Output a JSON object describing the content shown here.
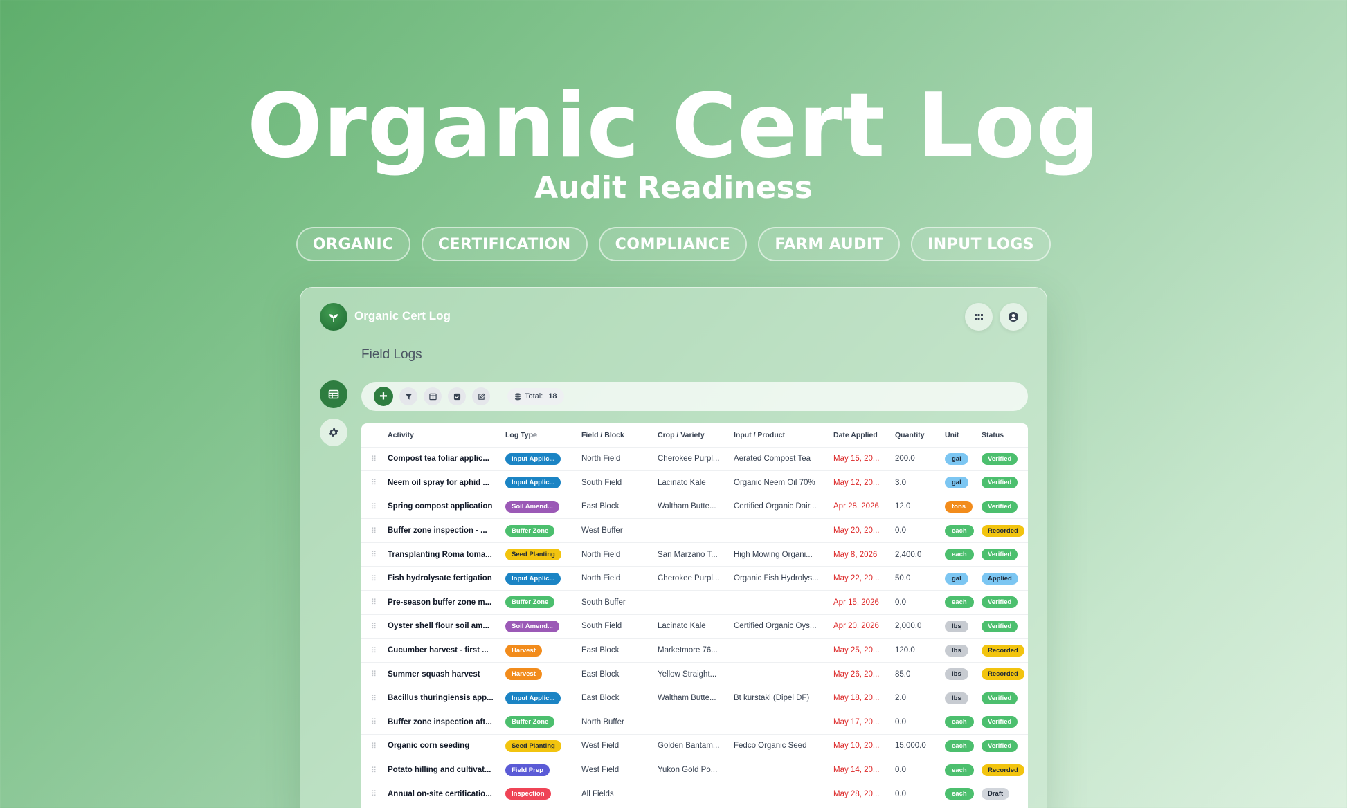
{
  "hero": {
    "title": "Organic Cert Log",
    "subtitle": "Audit Readiness",
    "tags": [
      "ORGANIC",
      "CERTIFICATION",
      "COMPLIANCE",
      "FARM AUDIT",
      "INPUT LOGS"
    ]
  },
  "app": {
    "title": "Organic Cert Log",
    "page_heading": "Field Logs",
    "toolbar": {
      "total_label": "Total:",
      "total_value": "18"
    },
    "columns": [
      "",
      "Activity",
      "Log Type",
      "Field / Block",
      "Crop / Variety",
      "Input / Product",
      "Date Applied",
      "Quantity",
      "Unit",
      "Status"
    ],
    "colors": {
      "brand": "#2e7d40",
      "input": "#1b84c4",
      "soil": "#9b59b6",
      "buffer": "#4cbf6e",
      "seed": "#f2c40f",
      "harvest": "#f28c1c",
      "fieldprep": "#5b5bd6",
      "inspection": "#ef4456",
      "gal": "#7cc6f2",
      "tons": "#f28c1c",
      "each": "#4cbf6e",
      "lbs": "#c7cbd1",
      "verified": "#4cbf6e",
      "recorded": "#f2c40f",
      "applied": "#7cc6f2",
      "draft": "#d1d5db"
    },
    "rows": [
      {
        "activity": "Compost tea foliar applic...",
        "type": "Input Applic...",
        "type_color": "input",
        "field": "North Field",
        "crop": "Cherokee Purpl...",
        "product": "Aerated Compost Tea",
        "date": "May 15, 20...",
        "qty": "200.0",
        "unit": "gal",
        "status": "Verified"
      },
      {
        "activity": "Neem oil spray for aphid ...",
        "type": "Input Applic...",
        "type_color": "input",
        "field": "South Field",
        "crop": "Lacinato Kale",
        "product": "Organic Neem Oil 70%",
        "date": "May 12, 20...",
        "qty": "3.0",
        "unit": "gal",
        "status": "Verified"
      },
      {
        "activity": "Spring compost application",
        "type": "Soil Amend...",
        "type_color": "soil",
        "field": "East Block",
        "crop": "Waltham Butte...",
        "product": "Certified Organic Dair...",
        "date": "Apr 28, 2026",
        "qty": "12.0",
        "unit": "tons",
        "status": "Verified"
      },
      {
        "activity": "Buffer zone inspection - ...",
        "type": "Buffer Zone",
        "type_color": "buffer",
        "field": "West Buffer",
        "crop": "",
        "product": "",
        "date": "May 20, 20...",
        "qty": "0.0",
        "unit": "each",
        "status": "Recorded"
      },
      {
        "activity": "Transplanting Roma toma...",
        "type": "Seed Planting",
        "type_color": "seed",
        "field": "North Field",
        "crop": "San Marzano T...",
        "product": "High Mowing Organi...",
        "date": "May 8, 2026",
        "qty": "2,400.0",
        "unit": "each",
        "status": "Verified"
      },
      {
        "activity": "Fish hydrolysate fertigation",
        "type": "Input Applic...",
        "type_color": "input",
        "field": "North Field",
        "crop": "Cherokee Purpl...",
        "product": "Organic Fish Hydrolys...",
        "date": "May 22, 20...",
        "qty": "50.0",
        "unit": "gal",
        "status": "Applied"
      },
      {
        "activity": "Pre-season buffer zone m...",
        "type": "Buffer Zone",
        "type_color": "buffer",
        "field": "South Buffer",
        "crop": "",
        "product": "",
        "date": "Apr 15, 2026",
        "qty": "0.0",
        "unit": "each",
        "status": "Verified"
      },
      {
        "activity": "Oyster shell flour soil am...",
        "type": "Soil Amend...",
        "type_color": "soil",
        "field": "South Field",
        "crop": "Lacinato Kale",
        "product": "Certified Organic Oys...",
        "date": "Apr 20, 2026",
        "qty": "2,000.0",
        "unit": "lbs",
        "status": "Verified"
      },
      {
        "activity": "Cucumber harvest - first ...",
        "type": "Harvest",
        "type_color": "harvest",
        "field": "East Block",
        "crop": "Marketmore 76...",
        "product": "",
        "date": "May 25, 20...",
        "qty": "120.0",
        "unit": "lbs",
        "status": "Recorded"
      },
      {
        "activity": "Summer squash harvest",
        "type": "Harvest",
        "type_color": "harvest",
        "field": "East Block",
        "crop": "Yellow Straight...",
        "product": "",
        "date": "May 26, 20...",
        "qty": "85.0",
        "unit": "lbs",
        "status": "Recorded"
      },
      {
        "activity": "Bacillus thuringiensis app...",
        "type": "Input Applic...",
        "type_color": "input",
        "field": "East Block",
        "crop": "Waltham Butte...",
        "product": "Bt kurstaki (Dipel DF)",
        "date": "May 18, 20...",
        "qty": "2.0",
        "unit": "lbs",
        "status": "Verified"
      },
      {
        "activity": "Buffer zone inspection aft...",
        "type": "Buffer Zone",
        "type_color": "buffer",
        "field": "North Buffer",
        "crop": "",
        "product": "",
        "date": "May 17, 20...",
        "qty": "0.0",
        "unit": "each",
        "status": "Verified"
      },
      {
        "activity": "Organic corn seeding",
        "type": "Seed Planting",
        "type_color": "seed",
        "field": "West Field",
        "crop": "Golden Bantam...",
        "product": "Fedco Organic Seed",
        "date": "May 10, 20...",
        "qty": "15,000.0",
        "unit": "each",
        "status": "Verified"
      },
      {
        "activity": "Potato hilling and cultivat...",
        "type": "Field Prep",
        "type_color": "fieldprep",
        "field": "West Field",
        "crop": "Yukon Gold Po...",
        "product": "",
        "date": "May 14, 20...",
        "qty": "0.0",
        "unit": "each",
        "status": "Recorded"
      },
      {
        "activity": "Annual on-site certificatio...",
        "type": "Inspection",
        "type_color": "inspection",
        "field": "All Fields",
        "crop": "",
        "product": "",
        "date": "May 28, 20...",
        "qty": "0.0",
        "unit": "each",
        "status": "Draft"
      }
    ]
  }
}
